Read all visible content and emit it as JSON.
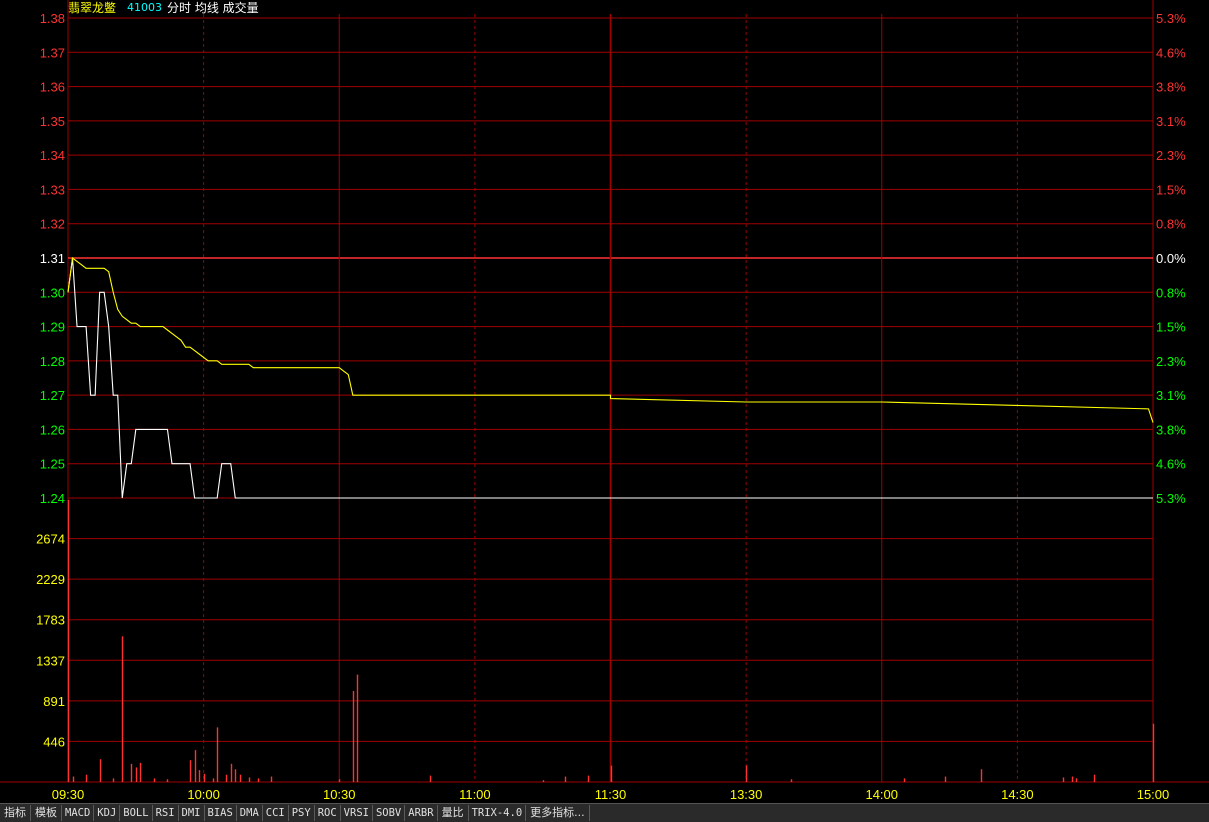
{
  "header": {
    "name": "翡翠龙鳖",
    "code": "41003",
    "indicators": "分时 均线 成交量"
  },
  "chart_data": [
    {
      "type": "line",
      "title": "",
      "x": [
        "09:30",
        "09:31",
        "09:32",
        "09:33",
        "09:34",
        "09:35",
        "09:36",
        "09:37",
        "09:38",
        "09:39",
        "09:40",
        "09:41",
        "09:42",
        "09:43",
        "09:44",
        "09:45",
        "09:46",
        "09:47",
        "09:48",
        "09:49",
        "09:50",
        "09:51",
        "09:52",
        "09:53",
        "09:54",
        "09:55",
        "09:56",
        "09:57",
        "09:58",
        "09:59",
        "10:00",
        "10:01",
        "10:02",
        "10:03",
        "10:04",
        "10:05",
        "10:06",
        "10:07",
        "10:08",
        "10:09",
        "10:10",
        "10:11",
        "10:12",
        "10:13",
        "10:14",
        "10:15",
        "10:30",
        "10:31",
        "10:32",
        "10:33",
        "11:00",
        "11:30",
        "13:00",
        "13:30",
        "14:00",
        "14:30",
        "14:59",
        "15:00"
      ],
      "series": [
        {
          "values": [
            1.3,
            1.31,
            1.29,
            1.29,
            1.29,
            1.27,
            1.27,
            1.3,
            1.3,
            1.29,
            1.27,
            1.27,
            1.24,
            1.25,
            1.25,
            1.26,
            1.26,
            1.26,
            1.26,
            1.26,
            1.26,
            1.26,
            1.26,
            1.25,
            1.25,
            1.25,
            1.25,
            1.25,
            1.24,
            1.24,
            1.24,
            1.24,
            1.24,
            1.24,
            1.25,
            1.25,
            1.25,
            1.24,
            1.24,
            1.24,
            1.24,
            1.24,
            1.24,
            1.24,
            1.24,
            1.24,
            1.24,
            1.24,
            1.24,
            1.24,
            1.24,
            1.24,
            1.24,
            1.24,
            1.24,
            1.24,
            1.24,
            1.24
          ],
          "color": "#ffffff"
        },
        {
          "values": [
            1.3,
            1.31,
            1.309,
            1.308,
            1.307,
            1.307,
            1.307,
            1.307,
            1.307,
            1.306,
            1.3,
            1.295,
            1.293,
            1.292,
            1.291,
            1.291,
            1.29,
            1.29,
            1.29,
            1.29,
            1.29,
            1.29,
            1.289,
            1.288,
            1.287,
            1.286,
            1.284,
            1.284,
            1.283,
            1.282,
            1.281,
            1.28,
            1.28,
            1.28,
            1.279,
            1.279,
            1.279,
            1.279,
            1.279,
            1.279,
            1.279,
            1.278,
            1.278,
            1.278,
            1.278,
            1.278,
            1.278,
            1.277,
            1.276,
            1.27,
            1.27,
            1.27,
            1.269,
            1.268,
            1.268,
            1.267,
            1.266,
            1.262
          ],
          "color": "#ffff00"
        }
      ],
      "prev_close": 1.31,
      "ylim": [
        1.24,
        1.38
      ],
      "yticks_left": [
        "1.38",
        "1.37",
        "1.36",
        "1.35",
        "1.34",
        "1.33",
        "1.32",
        "1.31",
        "1.30",
        "1.29",
        "1.28",
        "1.27",
        "1.26",
        "1.25",
        "1.24"
      ],
      "yticks_right": [
        "5.3%",
        "4.6%",
        "3.8%",
        "3.1%",
        "2.3%",
        "1.5%",
        "0.8%",
        "0.0%",
        "0.8%",
        "1.5%",
        "2.3%",
        "3.1%",
        "3.8%",
        "4.6%",
        "5.3%"
      ],
      "colors": {
        "up": "#ff3232",
        "flat": "#ffffff",
        "down": "#00ff00"
      }
    },
    {
      "type": "bar",
      "title": "",
      "ylim": [
        0,
        3120
      ],
      "yticks": [
        "2674",
        "2229",
        "1783",
        "1337",
        "891",
        "446"
      ],
      "ytick_values": [
        2674,
        2229,
        1783,
        1337,
        891,
        446
      ],
      "xtick_labels": [
        "09:30",
        "10:00",
        "10:30",
        "11:00",
        "11:30",
        "13:30",
        "14:00",
        "14:30",
        "15:00"
      ],
      "volume": [
        {
          "t": "09:30",
          "v": 3100
        },
        {
          "t": "09:31",
          "v": 60
        },
        {
          "t": "09:34",
          "v": 80
        },
        {
          "t": "09:37",
          "v": 250
        },
        {
          "t": "09:40",
          "v": 40
        },
        {
          "t": "09:42",
          "v": 1600
        },
        {
          "t": "09:44",
          "v": 200
        },
        {
          "t": "09:45",
          "v": 160
        },
        {
          "t": "09:46",
          "v": 210
        },
        {
          "t": "09:49",
          "v": 40
        },
        {
          "t": "09:52",
          "v": 30
        },
        {
          "t": "09:57",
          "v": 240
        },
        {
          "t": "09:58",
          "v": 350
        },
        {
          "t": "09:59",
          "v": 130
        },
        {
          "t": "10:00",
          "v": 90
        },
        {
          "t": "10:02",
          "v": 40
        },
        {
          "t": "10:03",
          "v": 600
        },
        {
          "t": "10:05",
          "v": 80
        },
        {
          "t": "10:06",
          "v": 200
        },
        {
          "t": "10:07",
          "v": 140
        },
        {
          "t": "10:08",
          "v": 80
        },
        {
          "t": "10:10",
          "v": 50
        },
        {
          "t": "10:12",
          "v": 40
        },
        {
          "t": "10:15",
          "v": 60
        },
        {
          "t": "10:30",
          "v": 30
        },
        {
          "t": "10:33",
          "v": 1000
        },
        {
          "t": "10:34",
          "v": 1180
        },
        {
          "t": "10:50",
          "v": 70
        },
        {
          "t": "11:15",
          "v": 20
        },
        {
          "t": "11:20",
          "v": 60
        },
        {
          "t": "11:25",
          "v": 70
        },
        {
          "t": "11:30",
          "v": 180
        },
        {
          "t": "13:30",
          "v": 180
        },
        {
          "t": "13:40",
          "v": 30
        },
        {
          "t": "14:05",
          "v": 40
        },
        {
          "t": "14:14",
          "v": 60
        },
        {
          "t": "14:22",
          "v": 140
        },
        {
          "t": "14:40",
          "v": 50
        },
        {
          "t": "14:42",
          "v": 60
        },
        {
          "t": "14:43",
          "v": 40
        },
        {
          "t": "14:47",
          "v": 80
        },
        {
          "t": "15:00",
          "v": 640
        }
      ],
      "bar_color": "#ff3232"
    }
  ],
  "tabs": [
    "指标",
    "模板",
    "MACD",
    "KDJ",
    "BOLL",
    "RSI",
    "DMI",
    "BIAS",
    "DMA",
    "CCI",
    "PSY",
    "ROC",
    "VRSI",
    "SOBV",
    "ARBR",
    "量比",
    "TRIX-4.0",
    "更多指标..."
  ]
}
